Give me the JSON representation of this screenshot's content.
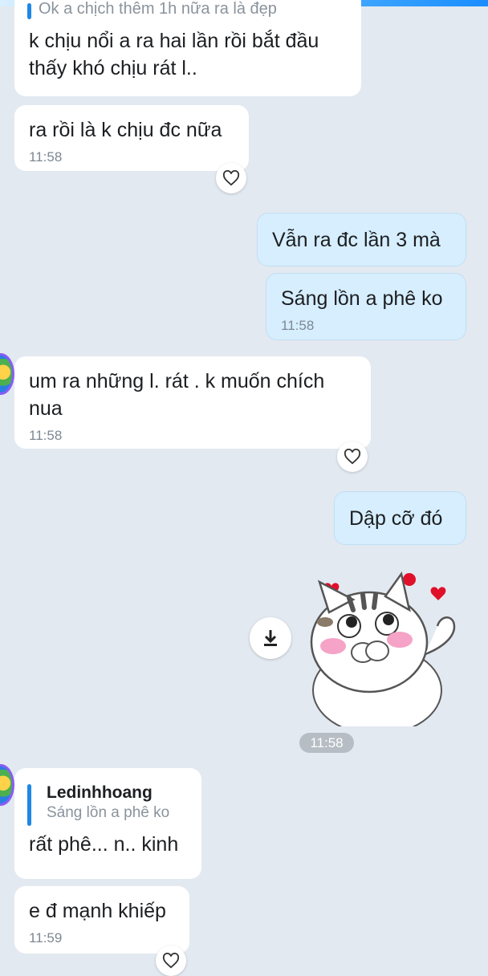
{
  "messages": {
    "m1": {
      "quote": "Ok a chịch thêm 1h nữa ra là đẹp",
      "text": "k chịu nổi a ra hai lần rồi bắt đầu\nthấy khó chịu rát l.."
    },
    "m2": {
      "text": "ra rồi là k chịu đc nữa",
      "time": "11:58"
    },
    "m3": {
      "text": "Vẫn ra đc lần 3 mà"
    },
    "m4": {
      "text": "Sáng lồn a phê ko",
      "time": "11:58"
    },
    "m5": {
      "text": "um ra những l.  rát . k muốn chích\nnua",
      "time": "11:58"
    },
    "m6": {
      "text": "Dập cỡ đó"
    },
    "sticker_time": "11:58",
    "m7": {
      "reply_name": "Ledinhhoang",
      "reply_text": "Sáng lồn a phê ko",
      "text": "rất phê... n.. kinh"
    },
    "m8": {
      "text": "e đ mạnh khiếp",
      "time": "11:59"
    }
  },
  "icons": {
    "reaction": "heart-outline-icon",
    "download": "download-arrow-icon",
    "sticker": "cat-sticker",
    "avatar": "contact-avatar"
  },
  "colors": {
    "background": "#e3e9f1",
    "incoming_bubble": "#ffffff",
    "outgoing_bubble": "#d6eefe",
    "quote_bar": "#1e88e5",
    "time_text": "#7d8894"
  }
}
